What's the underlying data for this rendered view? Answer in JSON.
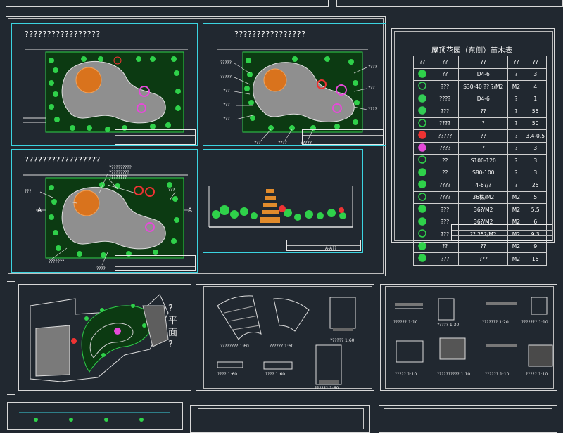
{
  "top_partial": {
    "title_left": "?",
    "title_right": "?"
  },
  "plans": {
    "plan1_title": "?????????????????",
    "plan2_title": "????????????????",
    "plan3_title": "?????????????????",
    "plan2_labels": [
      "?????",
      "?????",
      "???",
      "???",
      "???",
      "????",
      "???",
      "????",
      "???",
      "????",
      "?????",
      "??",
      "??"
    ],
    "plan3_labels": [
      "??????????",
      "?????????",
      "????????",
      "???",
      "???????",
      "???",
      "????",
      "A",
      "A"
    ],
    "section_label": "A-A??"
  },
  "tree_table": {
    "title": "屋顶花园（东侧）苗木表",
    "headers": [
      "??",
      "??",
      "??",
      "??",
      "??"
    ],
    "rows": [
      {
        "name": "??",
        "spec": "D4-6",
        "unit": "?",
        "qty": "3",
        "color": "#2fd14a"
      },
      {
        "name": "???",
        "spec": "S30-40 ?? ?/M2",
        "unit": "M2",
        "qty": "4",
        "color": "#33cc55"
      },
      {
        "name": "????",
        "spec": "D4-6",
        "unit": "?",
        "qty": "1",
        "color": "#33cc55"
      },
      {
        "name": "???",
        "spec": "??",
        "unit": "?",
        "qty": "55",
        "color": "#33cc55"
      },
      {
        "name": "????",
        "spec": "?",
        "unit": "?",
        "qty": "50",
        "color": "#2fd14a"
      },
      {
        "name": "?????",
        "spec": "??",
        "unit": "?",
        "qty": "3.4-0.5",
        "color": "#ee3333"
      },
      {
        "name": "????",
        "spec": "?",
        "unit": "?",
        "qty": "3",
        "color": "#e54ad9"
      },
      {
        "name": "??",
        "spec": "S100-120",
        "unit": "?",
        "qty": "3",
        "color": "#2fd14a"
      },
      {
        "name": "??",
        "spec": "S80-100",
        "unit": "?",
        "qty": "3",
        "color": "#2fd14a"
      },
      {
        "name": "????",
        "spec": "4-6?/?",
        "unit": "?",
        "qty": "25",
        "color": "#2fd14a"
      },
      {
        "name": "????",
        "spec": "36株/M2",
        "unit": "M2",
        "qty": "5",
        "color": "#2fd14a"
      },
      {
        "name": "???",
        "spec": "36?/M2",
        "unit": "M2",
        "qty": "5.5",
        "color": "#2fd14a"
      },
      {
        "name": "???",
        "spec": "36?/M2",
        "unit": "M2",
        "qty": "6",
        "color": "#2fd14a"
      },
      {
        "name": "???",
        "spec": "?? 25?/M2",
        "unit": "M2",
        "qty": "9.3",
        "color": "#2fd14a"
      },
      {
        "name": "??",
        "spec": "??",
        "unit": "M2",
        "qty": "9",
        "color": "#2fd14a"
      },
      {
        "name": "???",
        "spec": "???",
        "unit": "M2",
        "qty": "15",
        "color": "#2fd14a"
      }
    ]
  },
  "lower": {
    "plan_side_text": "? 平 面 ?",
    "detail_labels_1": [
      "???????? 1:60",
      "?????? 1:60",
      "?????? 1:60",
      "???? 1:60",
      "???? 1:60",
      "?????? 1:60"
    ],
    "detail_labels_2": [
      "?????? 1:10",
      "????? 1:30",
      "??????? 1:20",
      "??????? 1:10",
      "????? 1:10",
      "?????????? 1:10",
      "?????? 1:10",
      "????? 1:10"
    ]
  }
}
